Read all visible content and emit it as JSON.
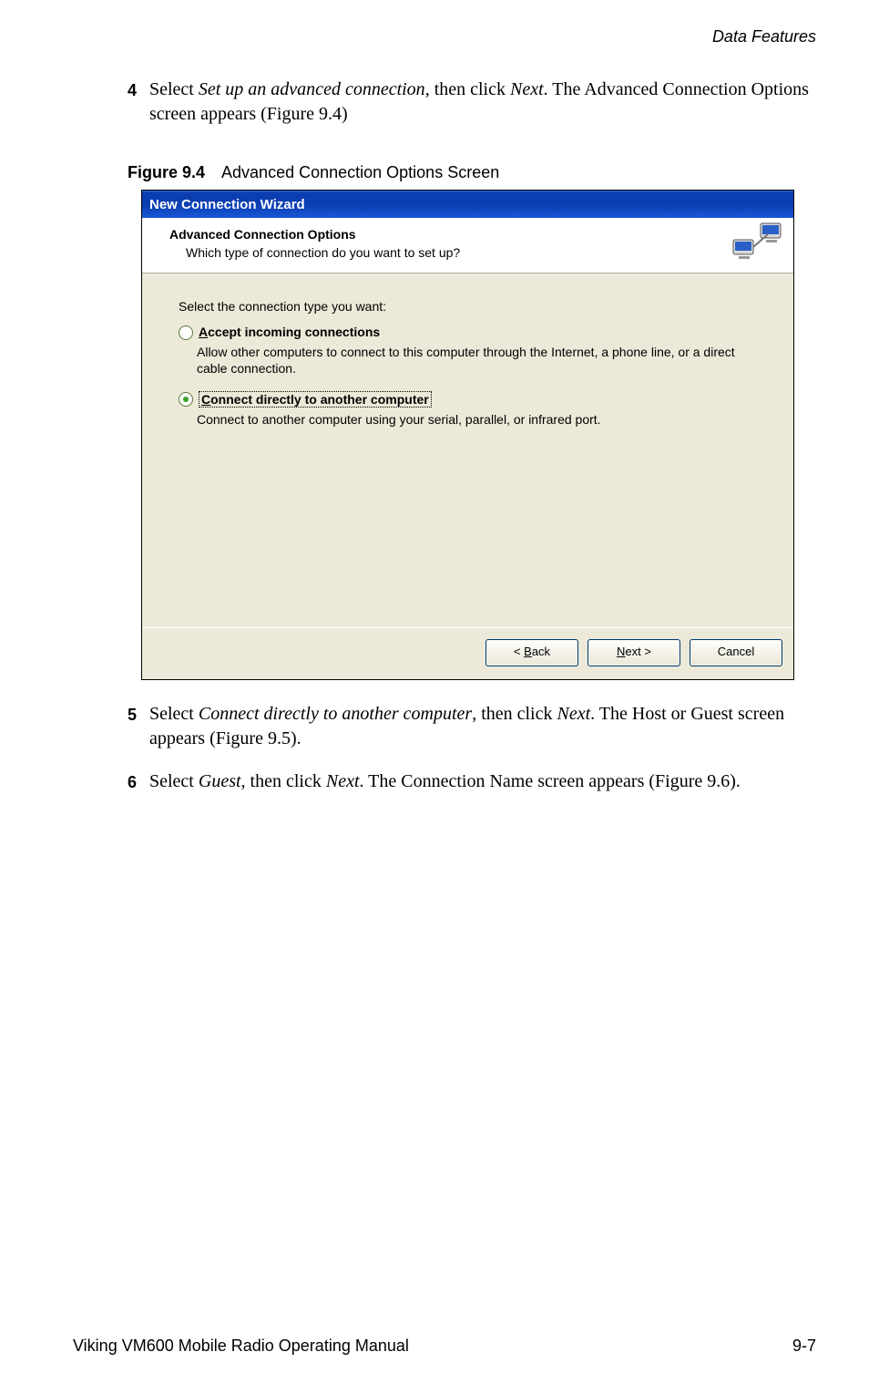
{
  "header": {
    "section": "Data Features"
  },
  "steps": {
    "s4": {
      "num": "4",
      "action": "Select ",
      "italic1": "Set up an advanced connection",
      "mid": ", then click ",
      "italic2": "Next",
      "tail": ". The Advanced Connection Options screen appears (Figure 9.4)"
    },
    "s5": {
      "num": "5",
      "action": "Select ",
      "italic1": "Connect directly to another computer",
      "mid": ", then click ",
      "italic2": "Next",
      "tail": ". The Host or Guest screen appears (Figure 9.5)."
    },
    "s6": {
      "num": "6",
      "action": "Select ",
      "italic1": "Guest",
      "mid": ", then click ",
      "italic2": "Next",
      "tail": ". The Connection Name screen appears (Figure 9.6)."
    }
  },
  "figure": {
    "label": "Figure 9.4",
    "caption": "Advanced Connection Options Screen"
  },
  "dialog": {
    "title": "New Connection Wizard",
    "header_title": "Advanced Connection Options",
    "header_sub": "Which type of connection do you want to set up?",
    "prompt": "Select the connection type you want:",
    "opt1": {
      "accel": "A",
      "rest": "ccept incoming connections",
      "desc": "Allow other computers to connect to this computer through the Internet, a phone line, or a direct cable connection."
    },
    "opt2": {
      "accel": "C",
      "rest": "onnect directly to another computer",
      "desc": "Connect to another computer using your serial, parallel, or infrared port."
    },
    "buttons": {
      "back_pre": "< ",
      "back_accel": "B",
      "back_rest": "ack",
      "next_accel": "N",
      "next_rest": "ext >",
      "cancel": "Cancel"
    }
  },
  "footer": {
    "left": "Viking VM600 Mobile Radio Operating Manual",
    "right": "9-7"
  }
}
